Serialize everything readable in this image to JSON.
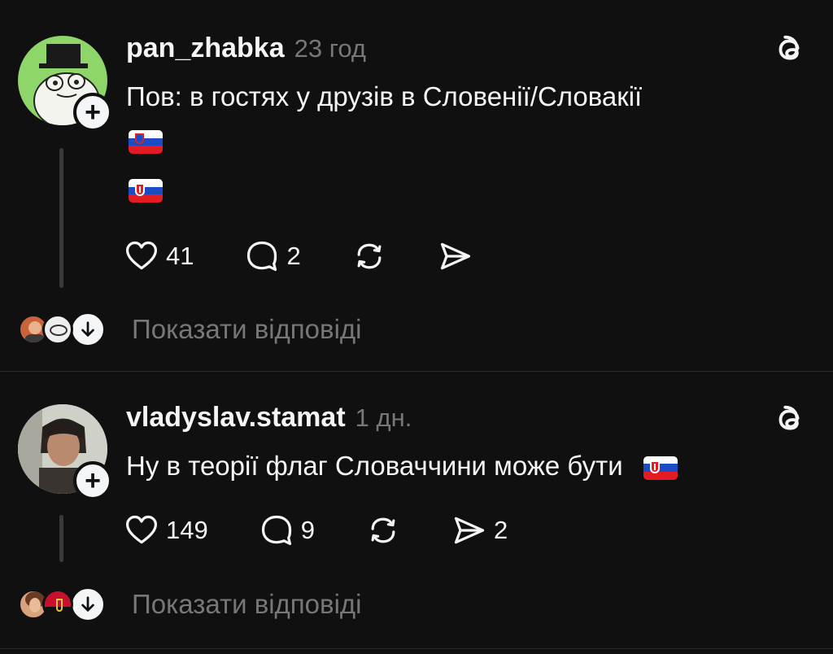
{
  "posts": [
    {
      "username": "pan_zhabka",
      "time": "23 год",
      "text": "Пов: в гостях у друзів в Словенії/Словакії",
      "likes": "41",
      "replies": "2",
      "reposts": "",
      "shares": "",
      "show_replies": "Показати відповіді"
    },
    {
      "username": "vladyslav.stamat",
      "time": "1 дн.",
      "text": "Ну в теорії флаг Словаччини може бути",
      "likes": "149",
      "replies": "9",
      "reposts": "",
      "shares": "2",
      "show_replies": "Показати відповіді"
    }
  ],
  "icons": {
    "like": "heart-icon",
    "reply": "comment-icon",
    "repost": "repost-icon",
    "share": "send-icon",
    "app": "threads-logo-icon",
    "follow": "plus-icon",
    "expand": "arrow-down-icon"
  },
  "colors": {
    "background": "#101010",
    "text": "#f3f5f7",
    "secondary": "#777777",
    "divider": "#2b2b2b"
  }
}
